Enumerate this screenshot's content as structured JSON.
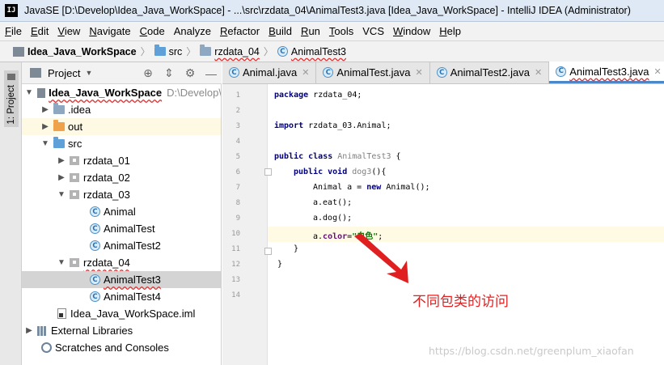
{
  "window": {
    "app_icon": "IJ",
    "title": "JavaSE [D:\\Develop\\Idea_Java_WorkSpace] - ...\\src\\rzdata_04\\AnimalTest3.java [Idea_Java_WorkSpace] - IntelliJ IDEA (Administrator)"
  },
  "menu": [
    {
      "u": "F",
      "rest": "ile"
    },
    {
      "u": "E",
      "rest": "dit"
    },
    {
      "u": "V",
      "rest": "iew"
    },
    {
      "u": "N",
      "rest": "avigate"
    },
    {
      "u": "C",
      "rest": "ode"
    },
    {
      "u": "",
      "rest": "Analyze"
    },
    {
      "u": "R",
      "rest": "efactor"
    },
    {
      "u": "B",
      "rest": "uild"
    },
    {
      "u": "R",
      "rest": "un"
    },
    {
      "u": "T",
      "rest": "ools"
    },
    {
      "u": "",
      "rest": "VCS"
    },
    {
      "u": "W",
      "rest": "indow"
    },
    {
      "u": "H",
      "rest": "elp"
    }
  ],
  "breadcrumb": {
    "project": "Idea_Java_WorkSpace",
    "src": "src",
    "package": "rzdata_04",
    "file": "AnimalTest3",
    "separator": "〉"
  },
  "side_tab": {
    "label": "1: Project"
  },
  "project_panel": {
    "title": "Project",
    "tools": [
      "⊕",
      "⇕",
      "⚙",
      "—"
    ]
  },
  "tree": {
    "root_name": "Idea_Java_WorkSpace",
    "root_path": "D:\\Develop\\",
    "idea": ".idea",
    "out": "out",
    "src": "src",
    "pkg1": "rzdata_01",
    "pkg2": "rzdata_02",
    "pkg3": "rzdata_03",
    "animal": "Animal",
    "animaltest": "AnimalTest",
    "animaltest2": "AnimalTest2",
    "pkg4": "rzdata_04",
    "animaltest3": "AnimalTest3",
    "animaltest4": "AnimalTest4",
    "iml": "Idea_Java_WorkSpace.iml",
    "ext_libs": "External Libraries",
    "scratches": "Scratches and Consoles"
  },
  "tabs": [
    {
      "label": "Animal.java",
      "active": false
    },
    {
      "label": "AnimalTest.java",
      "active": false
    },
    {
      "label": "AnimalTest2.java",
      "active": false
    },
    {
      "label": "AnimalTest3.java",
      "active": true
    }
  ],
  "editor": {
    "line_numbers": [
      "1",
      "2",
      "3",
      "4",
      "5",
      "6",
      "7",
      "8",
      "9",
      "10",
      "11",
      "12",
      "13",
      "14"
    ],
    "code": {
      "l1_kw": "package",
      "l1_rest": " rzdata_04;",
      "l3_kw": "import",
      "l3_rest": " rzdata_03.Animal;",
      "l5_kw": "public class",
      "l5_name": " AnimalTest3",
      "l5_rest": " {",
      "l6_kw": "public void",
      "l6_name": " dog3",
      "l6_rest": "(){",
      "l7_a": "Animal a = ",
      "l7_kw": "new",
      "l7_b": " Animal();",
      "l8": "a.eat();",
      "l9": "a.dog();",
      "l10_a": "a.",
      "l10_field": "color",
      "l10_eq": "=",
      "l10_str": "\"白色\"",
      "l10_end": ";",
      "l11": "}",
      "l12": "}"
    }
  },
  "annotation": {
    "text": "不同包类的访问",
    "color": "#e02020"
  },
  "watermark": "https://blog.csdn.net/greenplum_xiaofan"
}
